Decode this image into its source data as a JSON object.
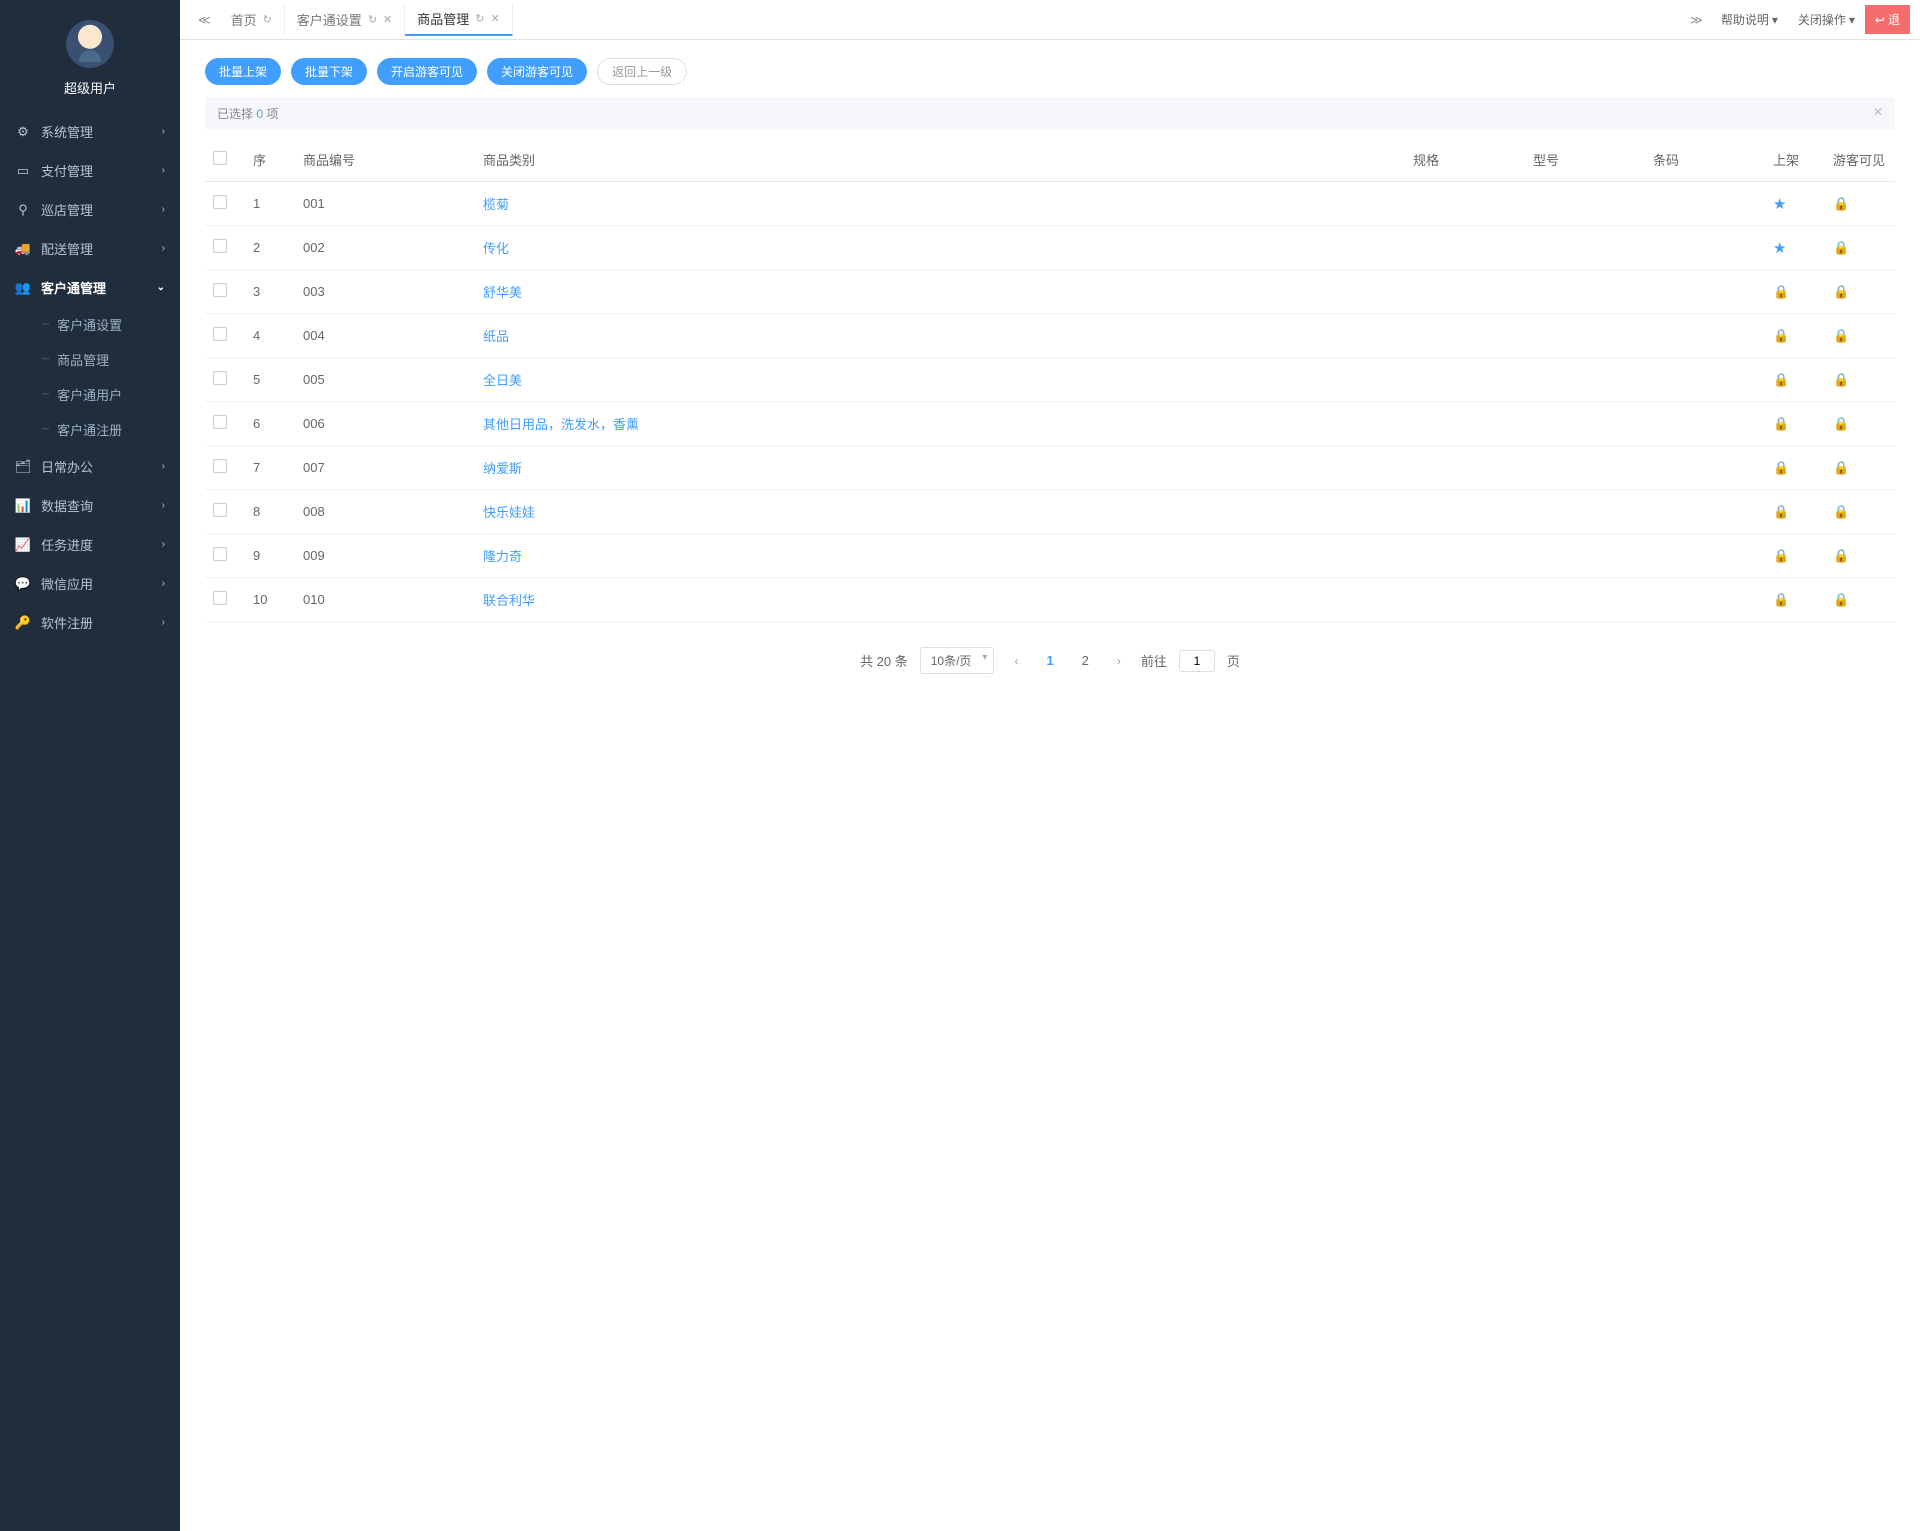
{
  "user": {
    "name": "超级用户"
  },
  "sidebar": {
    "items": [
      {
        "label": "系统管理",
        "icon": "⚙"
      },
      {
        "label": "支付管理",
        "icon": "▭"
      },
      {
        "label": "巡店管理",
        "icon": "⚲"
      },
      {
        "label": "配送管理",
        "icon": "🚚"
      },
      {
        "label": "客户通管理",
        "icon": "👥",
        "active": true
      },
      {
        "label": "日常办公",
        "icon": "🗂"
      },
      {
        "label": "数据查询",
        "icon": "📊"
      },
      {
        "label": "任务进度",
        "icon": "📈"
      },
      {
        "label": "微信应用",
        "icon": "💬"
      },
      {
        "label": "软件注册",
        "icon": "🔑"
      }
    ],
    "submenu": [
      {
        "label": "客户通设置"
      },
      {
        "label": "商品管理"
      },
      {
        "label": "客户通用户"
      },
      {
        "label": "客户通注册"
      }
    ]
  },
  "tabs": {
    "home": "首页",
    "t1": "客户通设置",
    "t2": "商品管理"
  },
  "topbar": {
    "help": "帮助说明",
    "closeop": "关闭操作",
    "logout": "退"
  },
  "actions": {
    "batch_on": "批量上架",
    "batch_off": "批量下架",
    "open_guest": "开启游客可见",
    "close_guest": "关闭游客可见",
    "back": "返回上一级"
  },
  "selected": {
    "prefix": "已选择 ",
    "count": "0",
    "suffix": " 项"
  },
  "columns": {
    "seq": "序",
    "code": "商品编号",
    "category": "商品类别",
    "spec": "规格",
    "model": "型号",
    "barcode": "条码",
    "onsale": "上架",
    "guest": "游客可见"
  },
  "rows": [
    {
      "seq": "1",
      "code": "001",
      "category": "榄菊",
      "star": true
    },
    {
      "seq": "2",
      "code": "002",
      "category": "传化",
      "star": true
    },
    {
      "seq": "3",
      "code": "003",
      "category": "舒华美",
      "star": false
    },
    {
      "seq": "4",
      "code": "004",
      "category": "纸品",
      "star": false
    },
    {
      "seq": "5",
      "code": "005",
      "category": "全日美",
      "star": false
    },
    {
      "seq": "6",
      "code": "006",
      "category": "其他日用品，洗发水，香薰",
      "star": false
    },
    {
      "seq": "7",
      "code": "007",
      "category": "纳爱斯",
      "star": false
    },
    {
      "seq": "8",
      "code": "008",
      "category": "快乐娃娃",
      "star": false
    },
    {
      "seq": "9",
      "code": "009",
      "category": "隆力奇",
      "star": false
    },
    {
      "seq": "10",
      "code": "010",
      "category": "联合利华",
      "star": false
    }
  ],
  "pagination": {
    "total": "共 20 条",
    "pagesize": "10条/页",
    "p1": "1",
    "p2": "2",
    "goto_prefix": "前往",
    "goto_val": "1",
    "goto_suffix": "页"
  }
}
